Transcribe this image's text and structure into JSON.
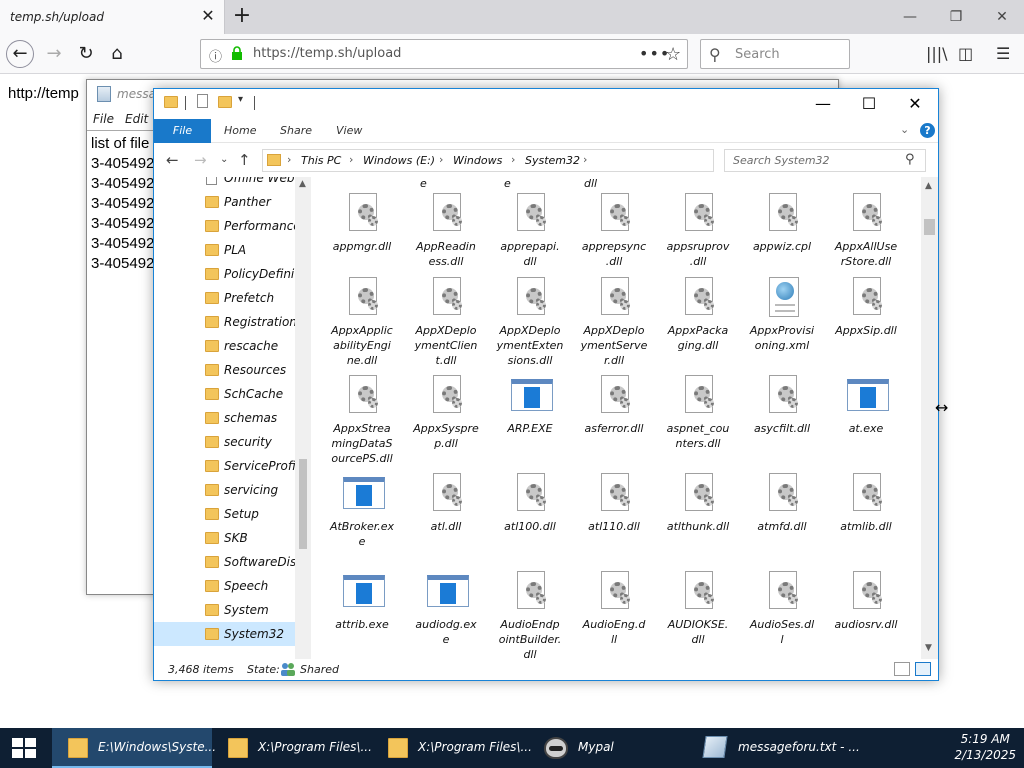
{
  "browser": {
    "tab_title": "temp.sh/upload",
    "url": "https://temp.sh/upload",
    "search_placeholder": "Search",
    "page_text": "http://temp"
  },
  "notepad": {
    "title": "message",
    "menu": [
      "File",
      "Edit"
    ],
    "lines": [
      "list of file",
      "3-405492",
      "3-405492",
      "3-405492",
      "3-405492",
      "3-405492",
      "3-405492"
    ]
  },
  "explorer": {
    "ribbon_tabs": [
      "File",
      "Home",
      "Share",
      "View"
    ],
    "breadcrumb": [
      "This PC",
      "Windows (E:)",
      "Windows",
      "System32"
    ],
    "search_placeholder": "Search System32",
    "nav_items": [
      {
        "label": "Offline Web P",
        "type": "page"
      },
      {
        "label": "Panther",
        "type": "folder"
      },
      {
        "label": "Performance",
        "type": "folder"
      },
      {
        "label": "PLA",
        "type": "folder"
      },
      {
        "label": "PolicyDefiniti",
        "type": "folder"
      },
      {
        "label": "Prefetch",
        "type": "folder"
      },
      {
        "label": "Registration",
        "type": "folder"
      },
      {
        "label": "rescache",
        "type": "folder"
      },
      {
        "label": "Resources",
        "type": "folder"
      },
      {
        "label": "SchCache",
        "type": "folder"
      },
      {
        "label": "schemas",
        "type": "folder"
      },
      {
        "label": "security",
        "type": "folder"
      },
      {
        "label": "ServiceProfile",
        "type": "folder"
      },
      {
        "label": "servicing",
        "type": "folder"
      },
      {
        "label": "Setup",
        "type": "folder"
      },
      {
        "label": "SKB",
        "type": "folder"
      },
      {
        "label": "SoftwareDistri",
        "type": "folder"
      },
      {
        "label": "Speech",
        "type": "folder"
      },
      {
        "label": "System",
        "type": "folder"
      },
      {
        "label": "System32",
        "type": "folder",
        "selected": true
      }
    ],
    "partial_row": [
      "e",
      "e",
      "dll"
    ],
    "files": [
      {
        "name": "appmgr.dll",
        "type": "dll"
      },
      {
        "name": "AppReadin ess.dll",
        "type": "dll"
      },
      {
        "name": "apprepapi. dll",
        "type": "dll"
      },
      {
        "name": "apprepsync .dll",
        "type": "dll"
      },
      {
        "name": "appsruprov .dll",
        "type": "dll"
      },
      {
        "name": "appwiz.cpl",
        "type": "dll"
      },
      {
        "name": "AppxAllUse rStore.dll",
        "type": "dll"
      },
      {
        "name": "AppxApplic abilityEngi ne.dll",
        "type": "dll"
      },
      {
        "name": "AppXDeplo ymentClien t.dll",
        "type": "dll"
      },
      {
        "name": "AppXDeplo ymentExten sions.dll",
        "type": "dll"
      },
      {
        "name": "AppXDeplo ymentServe r.dll",
        "type": "dll"
      },
      {
        "name": "AppxPacka ging.dll",
        "type": "dll"
      },
      {
        "name": "AppxProvisi oning.xml",
        "type": "xml"
      },
      {
        "name": "AppxSip.dll",
        "type": "dll"
      },
      {
        "name": "AppxStrea mingDataS ourcePS.dll",
        "type": "dll"
      },
      {
        "name": "AppxSyspre p.dll",
        "type": "dll"
      },
      {
        "name": "ARP.EXE",
        "type": "exe"
      },
      {
        "name": "asferror.dll",
        "type": "dll"
      },
      {
        "name": "aspnet_cou nters.dll",
        "type": "dll"
      },
      {
        "name": "asycfilt.dll",
        "type": "dll"
      },
      {
        "name": "at.exe",
        "type": "exe"
      },
      {
        "name": "AtBroker.ex e",
        "type": "exe"
      },
      {
        "name": "atl.dll",
        "type": "dll"
      },
      {
        "name": "atl100.dll",
        "type": "dll"
      },
      {
        "name": "atl110.dll",
        "type": "dll"
      },
      {
        "name": "atlthunk.dll",
        "type": "dll"
      },
      {
        "name": "atmfd.dll",
        "type": "dll"
      },
      {
        "name": "atmlib.dll",
        "type": "dll"
      },
      {
        "name": "attrib.exe",
        "type": "exe"
      },
      {
        "name": "audiodg.ex e",
        "type": "exe"
      },
      {
        "name": "AudioEndp ointBuilder. dll",
        "type": "dll"
      },
      {
        "name": "AudioEng.d ll",
        "type": "dll"
      },
      {
        "name": "AUDIOKSE. dll",
        "type": "dll"
      },
      {
        "name": "AudioSes.dl l",
        "type": "dll"
      },
      {
        "name": "audiosrv.dll",
        "type": "dll"
      }
    ],
    "status": {
      "items": "3,468 items",
      "state_label": "State:",
      "state_value": "Shared"
    }
  },
  "taskbar": {
    "items": [
      {
        "label": "E:\\Windows\\Syste...",
        "icon": "folder-icon",
        "active": true
      },
      {
        "label": "X:\\Program Files\\...",
        "icon": "folder-icon",
        "active": false
      },
      {
        "label": "X:\\Program Files\\...",
        "icon": "folder-icon",
        "active": false
      },
      {
        "label": "Mypal",
        "icon": "raccoon-icon",
        "active": false
      },
      {
        "label": "messageforu.txt - ...",
        "icon": "notepad-icon",
        "active": false
      }
    ],
    "time": "5:19 AM",
    "date": "2/13/2025"
  }
}
